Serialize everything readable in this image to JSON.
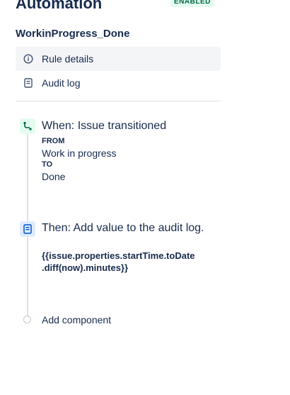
{
  "header": {
    "title": "Automation",
    "status_badge": "ENABLED"
  },
  "rule": {
    "name": "WorkinProgress_Done"
  },
  "nav": {
    "items": [
      {
        "label": "Rule details",
        "icon": "info-icon",
        "active": true
      },
      {
        "label": "Audit log",
        "icon": "audit-log-icon",
        "active": false
      }
    ]
  },
  "components": {
    "trigger": {
      "icon": "trigger-branch-icon",
      "title": "When: Issue transitioned",
      "from_label": "FROM",
      "from_value": "Work in progress",
      "to_label": "TO",
      "to_value": "Done"
    },
    "action": {
      "icon": "document-icon",
      "title": "Then: Add value to the audit log.",
      "code_line1": "{{issue.properties.startTime.toDate",
      "code_line2": ".diff(now).minutes}}"
    }
  },
  "add_component_label": "Add component",
  "colors": {
    "accent_green": "#006644",
    "badge_green_bg": "#e3fcef",
    "action_blue": "#0052cc",
    "action_blue_bg": "#deebff",
    "text": "#172b4d"
  }
}
